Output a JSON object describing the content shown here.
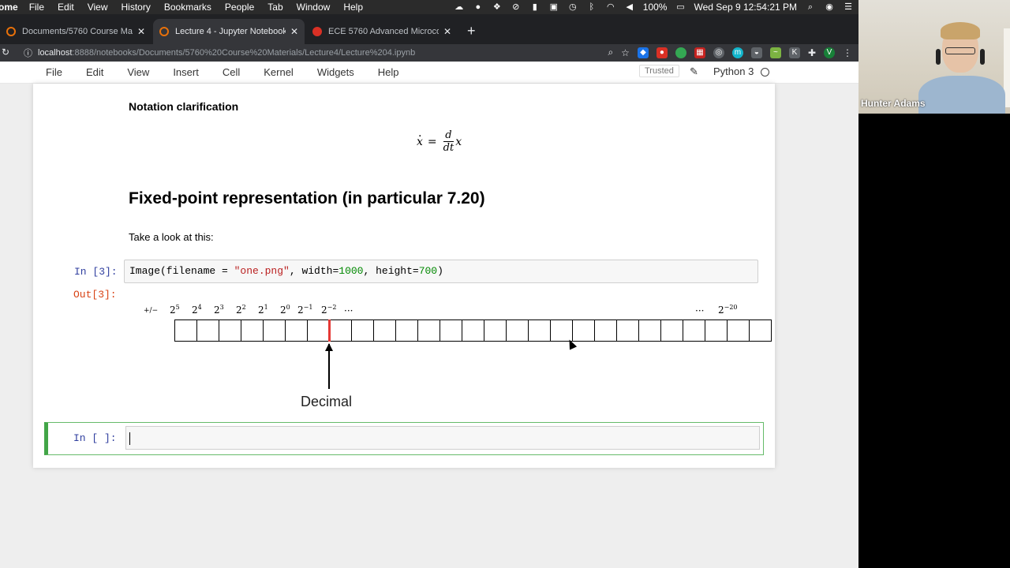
{
  "menubar": {
    "app": "ome",
    "items": [
      "File",
      "Edit",
      "View",
      "History",
      "Bookmarks",
      "People",
      "Tab",
      "Window",
      "Help"
    ],
    "battery": "100%",
    "clock": "Wed Sep 9  12:54:21 PM"
  },
  "tabs": [
    {
      "title": "Documents/5760 Course Mate",
      "favicon_color": "#e8710a"
    },
    {
      "title": "Lecture 4 - Jupyter Notebook",
      "favicon_color": "#e8710a"
    },
    {
      "title": "ECE 5760 Advanced Microcon",
      "favicon_color": "#d93025"
    }
  ],
  "address": {
    "host": "localhost",
    "path": ":8888/notebooks/Documents/5760%20Course%20Materials/Lecture4/Lecture%204.ipynb"
  },
  "jupyter_menu": {
    "items": [
      "File",
      "Edit",
      "View",
      "Insert",
      "Cell",
      "Kernel",
      "Widgets",
      "Help"
    ],
    "trusted": "Trusted",
    "kernel": "Python 3"
  },
  "cells": {
    "notation_heading": "Notation clarification",
    "math": {
      "lhs": "x",
      "eq": "=",
      "num": "d",
      "den": "dt",
      "rhs": "x"
    },
    "section_heading": "Fixed-point representation (in particular 7.20)",
    "intro": "Take a look at this:",
    "code_prompt": "In [3]:",
    "code": {
      "p1": "Image(filename = ",
      "str": "\"one.png\"",
      "p2": ", width=",
      "n1": "1000",
      "p3": ", height=",
      "n2": "700",
      "p4": ")"
    },
    "out_prompt": "Out[3]:",
    "empty_prompt": "In [ ]:"
  },
  "figure": {
    "sign": "+/−",
    "exponents": [
      "5",
      "4",
      "3",
      "2",
      "1",
      "0",
      "−1",
      "−2"
    ],
    "ellipsis": "···",
    "last_exponent": "−20",
    "base": "2",
    "decimal_label": "Decimal",
    "cell_count": 27
  },
  "webcam": {
    "name": "Hunter Adams"
  },
  "colors": {
    "highlight": "#e53935",
    "selected_cell": "#42a547",
    "out_prompt": "#d84315",
    "in_prompt": "#303f9f"
  }
}
